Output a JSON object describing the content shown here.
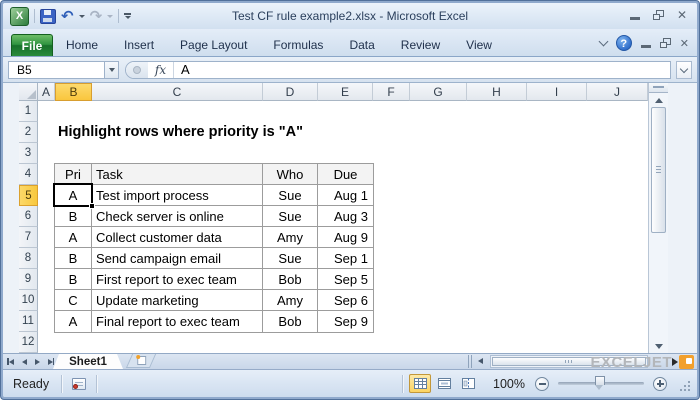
{
  "window": {
    "title": "Test CF rule example2.xlsx  -  Microsoft Excel"
  },
  "ribbon": {
    "tabs": [
      "File",
      "Home",
      "Insert",
      "Page Layout",
      "Formulas",
      "Data",
      "Review",
      "View"
    ]
  },
  "formula_bar": {
    "name_box": "B5",
    "fx_label": "fx",
    "formula": "A"
  },
  "grid": {
    "column_headers": [
      "A",
      "B",
      "C",
      "D",
      "E",
      "F",
      "G",
      "H",
      "I",
      "J"
    ],
    "row_headers": [
      "1",
      "2",
      "3",
      "4",
      "5",
      "6",
      "7",
      "8",
      "9",
      "10",
      "11",
      "12"
    ],
    "selected_cell": "B5",
    "selected_column": "B",
    "selected_row": "5",
    "heading": "Highlight rows where priority is \"A\"",
    "table": {
      "headers": [
        "Pri",
        "Task",
        "Who",
        "Due"
      ],
      "rows": [
        [
          "A",
          "Test import process",
          "Sue",
          "Aug 1"
        ],
        [
          "B",
          "Check server is online",
          "Sue",
          "Aug 3"
        ],
        [
          "A",
          "Collect customer data",
          "Amy",
          "Aug 9"
        ],
        [
          "B",
          "Send campaign email",
          "Sue",
          "Sep 1"
        ],
        [
          "B",
          "First report to exec team",
          "Bob",
          "Sep 5"
        ],
        [
          "C",
          "Update marketing",
          "Amy",
          "Sep 6"
        ],
        [
          "A",
          "Final report to exec team",
          "Bob",
          "Sep 9"
        ]
      ]
    }
  },
  "sheet_bar": {
    "tabs": [
      "Sheet1"
    ],
    "active_tab": "Sheet1"
  },
  "status_bar": {
    "mode": "Ready",
    "zoom_level": "100%"
  },
  "branding": {
    "logo_text": "EXCELJET"
  },
  "icons": {
    "excel_logo": "X",
    "undo": "↶",
    "redo": "↷",
    "help": "?",
    "close": "✕"
  },
  "colors": {
    "file_tab_green": "#2a8b3b",
    "selected_header_fill": "#f9c63d",
    "selection_border": "#000000",
    "logo_orange": "#f2a02d",
    "table_border_gray": "#9c9c9c"
  }
}
